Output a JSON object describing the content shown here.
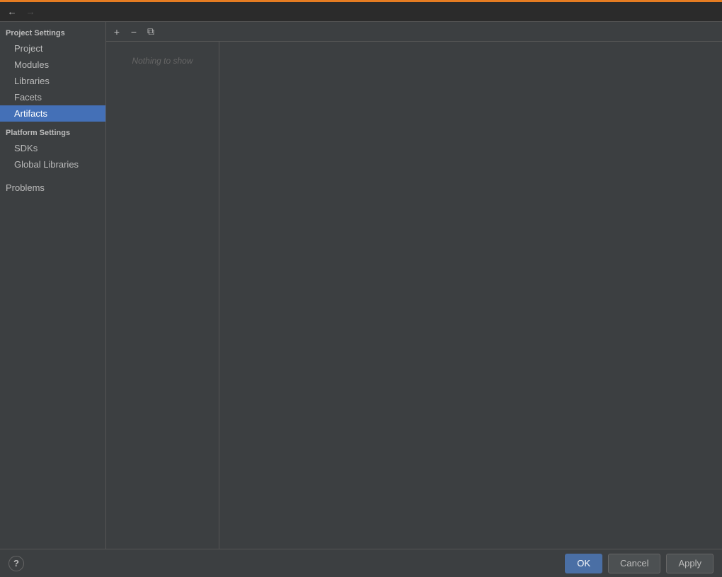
{
  "topAccent": {
    "color": "#e57c22"
  },
  "topBar": {
    "backArrow": "←",
    "forwardArrow": "→"
  },
  "sidebar": {
    "projectSettingsHeader": "Project Settings",
    "items": [
      {
        "label": "Project",
        "active": false
      },
      {
        "label": "Modules",
        "active": false
      },
      {
        "label": "Libraries",
        "active": false
      },
      {
        "label": "Facets",
        "active": false
      },
      {
        "label": "Artifacts",
        "active": true
      }
    ],
    "platformSettingsHeader": "Platform Settings",
    "platformItems": [
      {
        "label": "SDKs",
        "active": false
      },
      {
        "label": "Global Libraries",
        "active": false
      }
    ],
    "problemsLabel": "Problems"
  },
  "toolbar": {
    "addIcon": "+",
    "removeIcon": "−",
    "copyIcon": "⧉"
  },
  "listPanel": {
    "emptyText": "Nothing to show"
  },
  "bottomBar": {
    "helpIcon": "?",
    "okLabel": "OK",
    "cancelLabel": "Cancel",
    "applyLabel": "Apply"
  }
}
